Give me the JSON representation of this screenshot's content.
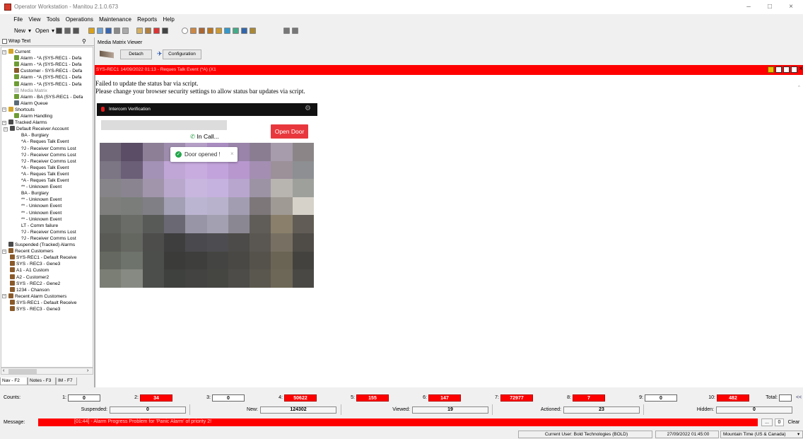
{
  "window": {
    "title": "Operator Workstation - Manitou 2.1.0.673",
    "minimize": "–",
    "maximize": "□",
    "close": "×"
  },
  "menu": [
    "File",
    "View",
    "Tools",
    "Operations",
    "Maintenance",
    "Reports",
    "Help"
  ],
  "toolbar": {
    "new_label": "New",
    "open_label": "Open"
  },
  "left_panel": {
    "wrap_text": "Wrap Text",
    "tree": [
      {
        "label": "Current",
        "depth": 0,
        "toggle": "−",
        "icon": "folder"
      },
      {
        "label": "Alarm - *A (SYS-REC1 - Defa",
        "depth": 2,
        "icon": "alarm"
      },
      {
        "label": "Alarm - *A (SYS-REC1 - Defa",
        "depth": 2,
        "icon": "alarm"
      },
      {
        "label": "Customer - SYS-REC1 - Defa",
        "depth": 2,
        "icon": "customer"
      },
      {
        "label": "Alarm - *A (SYS-REC1 - Defa",
        "depth": 2,
        "icon": "alarm"
      },
      {
        "label": "Alarm - *A (SYS-REC1 - Defa",
        "depth": 2,
        "icon": "alarm"
      },
      {
        "label": "Media Matrix",
        "depth": 2,
        "icon": "media",
        "dim": true
      },
      {
        "label": "Alarm - BA (SYS-REC1 - Defa",
        "depth": 2,
        "icon": "alarm"
      },
      {
        "label": "Alarm Queue",
        "depth": 2,
        "icon": "queue"
      },
      {
        "label": "Shortcuts",
        "depth": 0,
        "toggle": "−",
        "icon": "folder"
      },
      {
        "label": "Alarm Handling",
        "depth": 2,
        "icon": "alarm"
      },
      {
        "label": "Tracked Alarms",
        "depth": 0,
        "toggle": "−",
        "icon": "tracked"
      },
      {
        "label": "Default Receiver Account",
        "depth": 1,
        "toggle": "−",
        "icon": "tracked"
      },
      {
        "label": "BA - Burglary",
        "depth": 3
      },
      {
        "label": "*A - Reques Talk Event",
        "depth": 3
      },
      {
        "label": "?J - Receiver Comms Lost",
        "depth": 3
      },
      {
        "label": "?J - Receiver Comms Lost",
        "depth": 3
      },
      {
        "label": "?J - Receiver Comms Lost",
        "depth": 3
      },
      {
        "label": "*A - Reques Talk Event",
        "depth": 3
      },
      {
        "label": "*A - Reques Talk Event",
        "depth": 3
      },
      {
        "label": "*A - Reques Talk Event",
        "depth": 3
      },
      {
        "label": "** - Unknown Event",
        "depth": 3
      },
      {
        "label": "BA - Burglary",
        "depth": 3
      },
      {
        "label": "** - Unknown Event",
        "depth": 3
      },
      {
        "label": "** - Unknown Event",
        "depth": 3
      },
      {
        "label": "** - Unknown Event",
        "depth": 3
      },
      {
        "label": "** - Unknown Event",
        "depth": 3
      },
      {
        "label": "LT - Comm failure",
        "depth": 3
      },
      {
        "label": "?J - Receiver Comms Lost",
        "depth": 3
      },
      {
        "label": "?J - Receiver Comms Lost",
        "depth": 3
      },
      {
        "label": "Suspended (Tracked) Alarms",
        "depth": 0,
        "icon": "tracked"
      },
      {
        "label": "Recent Customers",
        "depth": 0,
        "toggle": "−",
        "icon": "customer"
      },
      {
        "label": "SYS-REC1 - Default Receive",
        "depth": 1,
        "icon": "customer"
      },
      {
        "label": "SYS - REC3 - Gene3",
        "depth": 1,
        "icon": "customer"
      },
      {
        "label": "A1 - A1 Custom",
        "depth": 1,
        "icon": "customer"
      },
      {
        "label": "A2 - Customer2",
        "depth": 1,
        "icon": "customer"
      },
      {
        "label": "SYS - REC2 - Gene2",
        "depth": 1,
        "icon": "customer"
      },
      {
        "label": "1234 - Chanson",
        "depth": 1,
        "icon": "customer"
      },
      {
        "label": "Recent Alarm Customers",
        "depth": 0,
        "toggle": "−",
        "icon": "customer"
      },
      {
        "label": "SYS-REC1 - Default Receive",
        "depth": 1,
        "icon": "customer"
      },
      {
        "label": "SYS - REC3 - Gene3",
        "depth": 1,
        "icon": "customer"
      }
    ],
    "tabs": [
      "Nav - F2",
      "Notes - F3",
      "IM - F7"
    ]
  },
  "media_matrix": {
    "title": "Media Matrix Viewer",
    "detach": "Detach",
    "configuration": "Configuration",
    "alarm_title": "SYS-REC1 14/09/2022 01:13 - Reques Talk Event (*A) (X1",
    "error_line1": "Failed to update the status bar via script.",
    "error_line2": "Please change your browser security settings to allow status bar updates via script."
  },
  "intercom": {
    "title": "Intercom Verification",
    "in_call": "In Call...",
    "open_door": "Open Door",
    "toast": "Door opened !",
    "toast_close": "×"
  },
  "counts": {
    "label": "Counts:",
    "items": [
      {
        "n": "1:",
        "value": "0",
        "alert": false
      },
      {
        "n": "2:",
        "value": "34",
        "alert": true
      },
      {
        "n": "3:",
        "value": "0",
        "alert": false
      },
      {
        "n": "4:",
        "value": "50622",
        "alert": true
      },
      {
        "n": "5:",
        "value": "155",
        "alert": true
      },
      {
        "n": "6:",
        "value": "147",
        "alert": true
      },
      {
        "n": "7:",
        "value": "72977",
        "alert": true
      },
      {
        "n": "8:",
        "value": "7",
        "alert": true
      },
      {
        "n": "9:",
        "value": "0",
        "alert": false
      },
      {
        "n": "10:",
        "value": "482",
        "alert": true
      }
    ],
    "total_label": "Total:",
    "total_value": "",
    "nav": "<<"
  },
  "stats": [
    {
      "label": "Suspended:",
      "value": "0"
    },
    {
      "label": "New:",
      "value": "124302"
    },
    {
      "label": "Viewed:",
      "value": "19"
    },
    {
      "label": "Actioned:",
      "value": "23"
    },
    {
      "label": "Hidden:",
      "value": "0"
    }
  ],
  "message": {
    "label": "Message:",
    "text": "[01:44] - Alarm Progress Problem for 'Panic Alarm' of priority 2!",
    "dots": "...",
    "count": "0",
    "clear": "Clear"
  },
  "status": {
    "user": "Current User: Bold Technologies (BOLD)",
    "datetime": "27/09/2022 01:45:00",
    "timezone": "Mountain Time (US & Canada)"
  },
  "colors": {
    "alarm_red": "#ff0000",
    "success_green": "#22a64a",
    "open_door": "#e8383d"
  }
}
